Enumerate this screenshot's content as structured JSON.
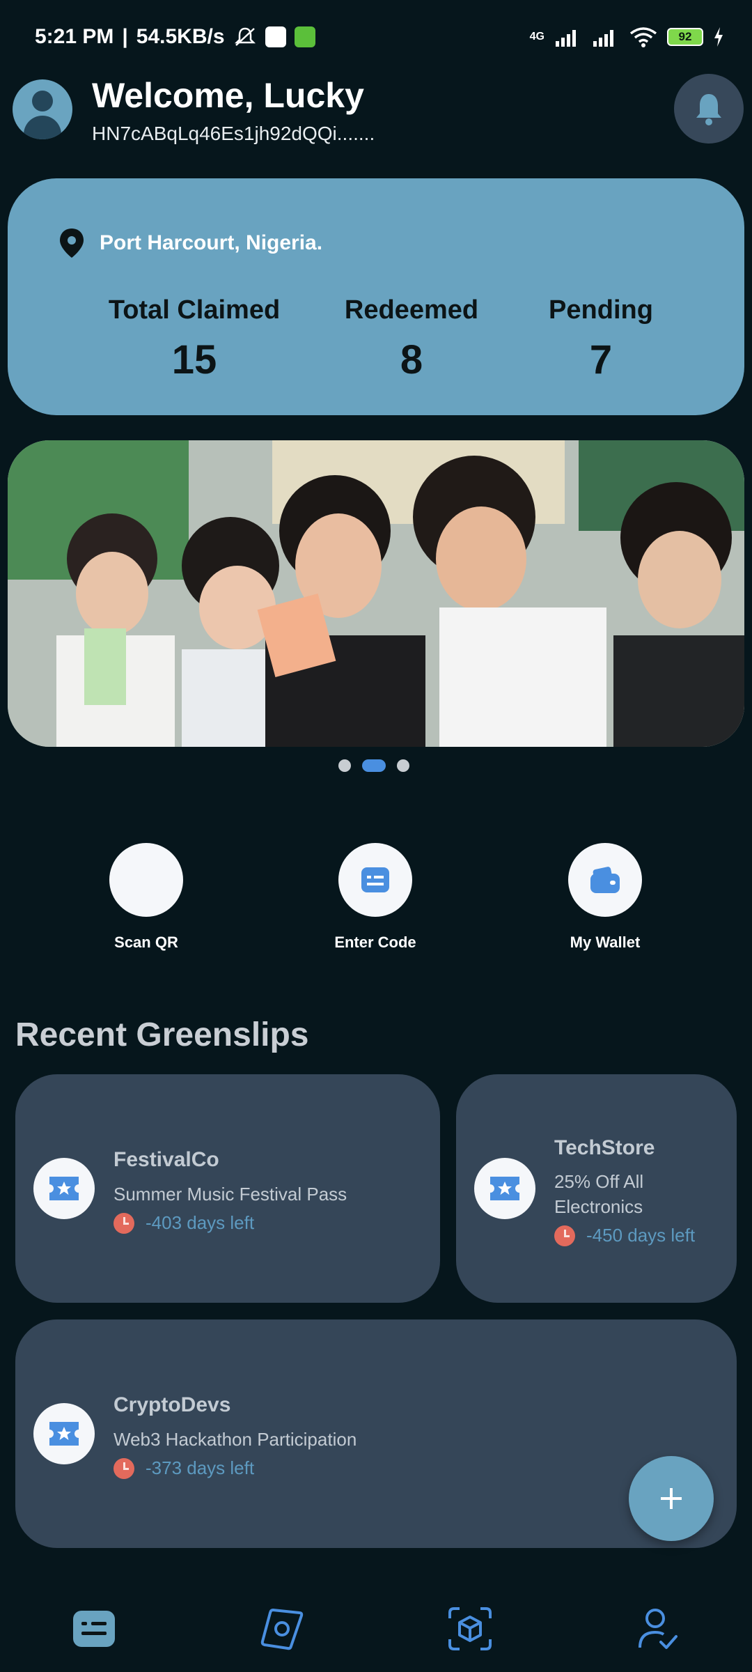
{
  "status_bar": {
    "time": "5:21 PM",
    "speed": "54.5KB/s",
    "network": "4G",
    "battery": "92"
  },
  "header": {
    "welcome": "Welcome, Lucky",
    "address": "HN7cABqLq46Es1jh92dQQi......."
  },
  "stats": {
    "location": "Port Harcourt, Nigeria.",
    "items": [
      {
        "label": "Total Claimed",
        "value": "15"
      },
      {
        "label": "Redeemed",
        "value": "8"
      },
      {
        "label": "Pending",
        "value": "7"
      }
    ]
  },
  "carousel": {
    "active_index": 1,
    "count": 3
  },
  "quick_actions": [
    {
      "label": "Scan QR",
      "icon": "qr-icon"
    },
    {
      "label": "Enter Code",
      "icon": "keyboard-icon"
    },
    {
      "label": "My Wallet",
      "icon": "wallet-icon"
    }
  ],
  "section_title": "Recent Greenslips",
  "greenslips": [
    {
      "merchant": "FestivalCo",
      "description": "Summer Music Festival Pass",
      "days_left": "-403 days left"
    },
    {
      "merchant": "TechStore",
      "description": "25% Off All Electronics",
      "days_left": "-450 days left"
    },
    {
      "merchant": "CryptoDevs",
      "description": "Web3 Hackathon Participation",
      "days_left": "-373 days left"
    }
  ],
  "colors": {
    "background": "#06161c",
    "accent": "#69a3c0",
    "card": "#354658",
    "days": "#5d9ac0",
    "clock": "#e36a5c",
    "active_dot": "#4a8fe0"
  }
}
